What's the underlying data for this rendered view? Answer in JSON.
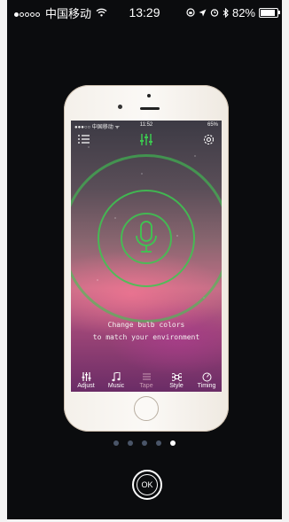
{
  "status_bar": {
    "carrier": "中国移动",
    "time": "13:29",
    "battery": "82%"
  },
  "inner_status_bar": {
    "carrier": "●●●○○ 中国移动 ᯤ",
    "time": "11:52",
    "battery": "65%"
  },
  "screen": {
    "tagline_line1": "Change bulb colors",
    "tagline_line2": "to match your environment"
  },
  "tabs": [
    {
      "label": "Adjust",
      "icon": "sliders-icon"
    },
    {
      "label": "Music",
      "icon": "music-note-icon"
    },
    {
      "label": "Tape",
      "icon": "tape-icon",
      "active": true
    },
    {
      "label": "Style",
      "icon": "command-icon"
    },
    {
      "label": "Timing",
      "icon": "timer-icon"
    }
  ],
  "pager": {
    "count": 5,
    "current": 5
  },
  "ok_button": {
    "label": "OK"
  },
  "colors": {
    "accent_green": "#3cc850",
    "active_tab": "#c99ab3",
    "background": "#0b0c0e"
  }
}
